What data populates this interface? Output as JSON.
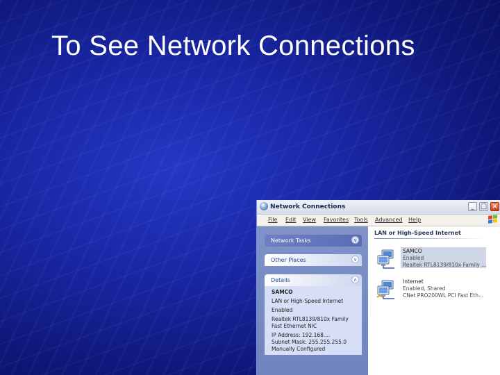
{
  "slide": {
    "title": "To See Network Connections"
  },
  "window": {
    "title": "Network Connections",
    "controls": {
      "minimize": "_",
      "maximize": "□",
      "close": "×"
    },
    "menu": [
      "File",
      "Edit",
      "View",
      "Favorites",
      "Tools",
      "Advanced",
      "Help"
    ]
  },
  "taskpane": {
    "network_tasks": "Network Tasks",
    "other_places": "Other Places",
    "details": {
      "header": "Details",
      "lines": [
        "SAMCO",
        "LAN or High-Speed Internet",
        "Enabled",
        "Realtek RTL8139/810x Family",
        "Fast Ethernet NIC",
        "IP Address: 192.168....",
        "Subnet Mask: 255.255.255.0",
        "Manually Configured"
      ]
    }
  },
  "main": {
    "group_title": "LAN or High-Speed Internet",
    "connections": [
      {
        "name": "SAMCO",
        "status": "Enabled",
        "device": "Realtek RTL8139/810x Family ..."
      },
      {
        "name": "Internet",
        "status": "Enabled, Shared",
        "device": "CNet PRO200WL PCI Fast Eth..."
      }
    ]
  },
  "icons": {
    "app": "network-connections-icon",
    "windows_logo": "windows-flag-icon",
    "connection": "network-computers-icon"
  },
  "colors": {
    "slide_background": "#1a27a6",
    "taskpane": "#7f93c9",
    "selection": "#cfd6e6"
  }
}
